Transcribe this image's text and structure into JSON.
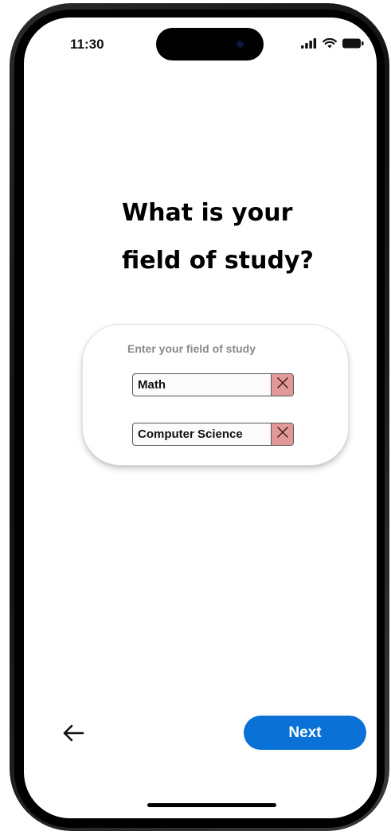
{
  "status_bar": {
    "time": "11:30",
    "icons": [
      "signal-icon",
      "wifi-icon",
      "battery-icon"
    ]
  },
  "question": {
    "line1": "What is your",
    "line2": "field of study?"
  },
  "input_card": {
    "label": "Enter your field of study",
    "entries": [
      {
        "value": "Math",
        "remove_icon": "close-icon"
      },
      {
        "value": "Computer Science",
        "remove_icon": "close-icon"
      }
    ]
  },
  "navigation": {
    "back_icon": "arrow-left-icon",
    "next_label": "Next"
  },
  "colors": {
    "primary": "#0a72d6",
    "remove_button": "#e29898",
    "label_gray": "#8a8a8a"
  }
}
